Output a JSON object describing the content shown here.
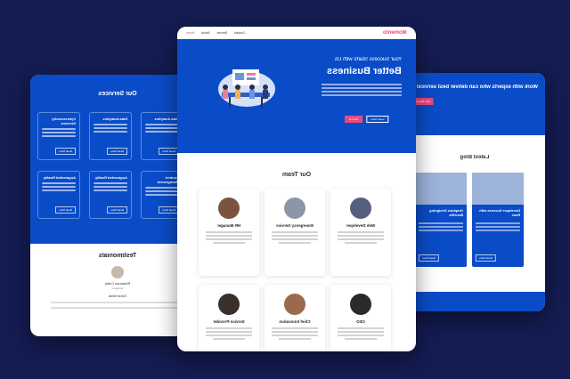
{
  "colors": {
    "background": "#141c52",
    "brand_blue": "#0a4cc8",
    "accent": "#e84a7f"
  },
  "main": {
    "logo": "Momento",
    "nav": [
      "Home",
      "About",
      "Service",
      "Contact"
    ],
    "hero": {
      "pre_title": "Your Success Starts with Us",
      "title": "Better Business",
      "primary_button": "Hire Us",
      "secondary_button": "Learn More"
    },
    "team": {
      "title": "Our Team",
      "members": [
        {
          "role": "Web Developer"
        },
        {
          "role": "Emergency Service"
        },
        {
          "role": "HR Manager"
        },
        {
          "role": "CEO"
        },
        {
          "role": "Chief Innovation"
        },
        {
          "role": "Service Provider"
        }
      ]
    }
  },
  "left_page": {
    "services_title": "Our Services",
    "services": [
      {
        "title": "Cybersecurity Services",
        "button": "Read More"
      },
      {
        "title": "Data Analytics",
        "button": "Read More"
      },
      {
        "title": "Augmented Reality",
        "button": "Read More"
      },
      {
        "title": "Content Management",
        "button": "Read More"
      }
    ],
    "testimonials_title": "Testimonials",
    "testimonial": {
      "name": "Rhiannon Colby",
      "role": "Designer",
      "quote": "Great Work"
    }
  },
  "right_page": {
    "headline": "Work with experts who can deliver best service!",
    "button": "Hire Experts",
    "blog_title": "Latest Blog",
    "posts": [
      {
        "title": "Developer Success with Ease",
        "button": "Read More"
      },
      {
        "title": "Graphics Designing Benefits",
        "button": "Read More"
      }
    ]
  }
}
